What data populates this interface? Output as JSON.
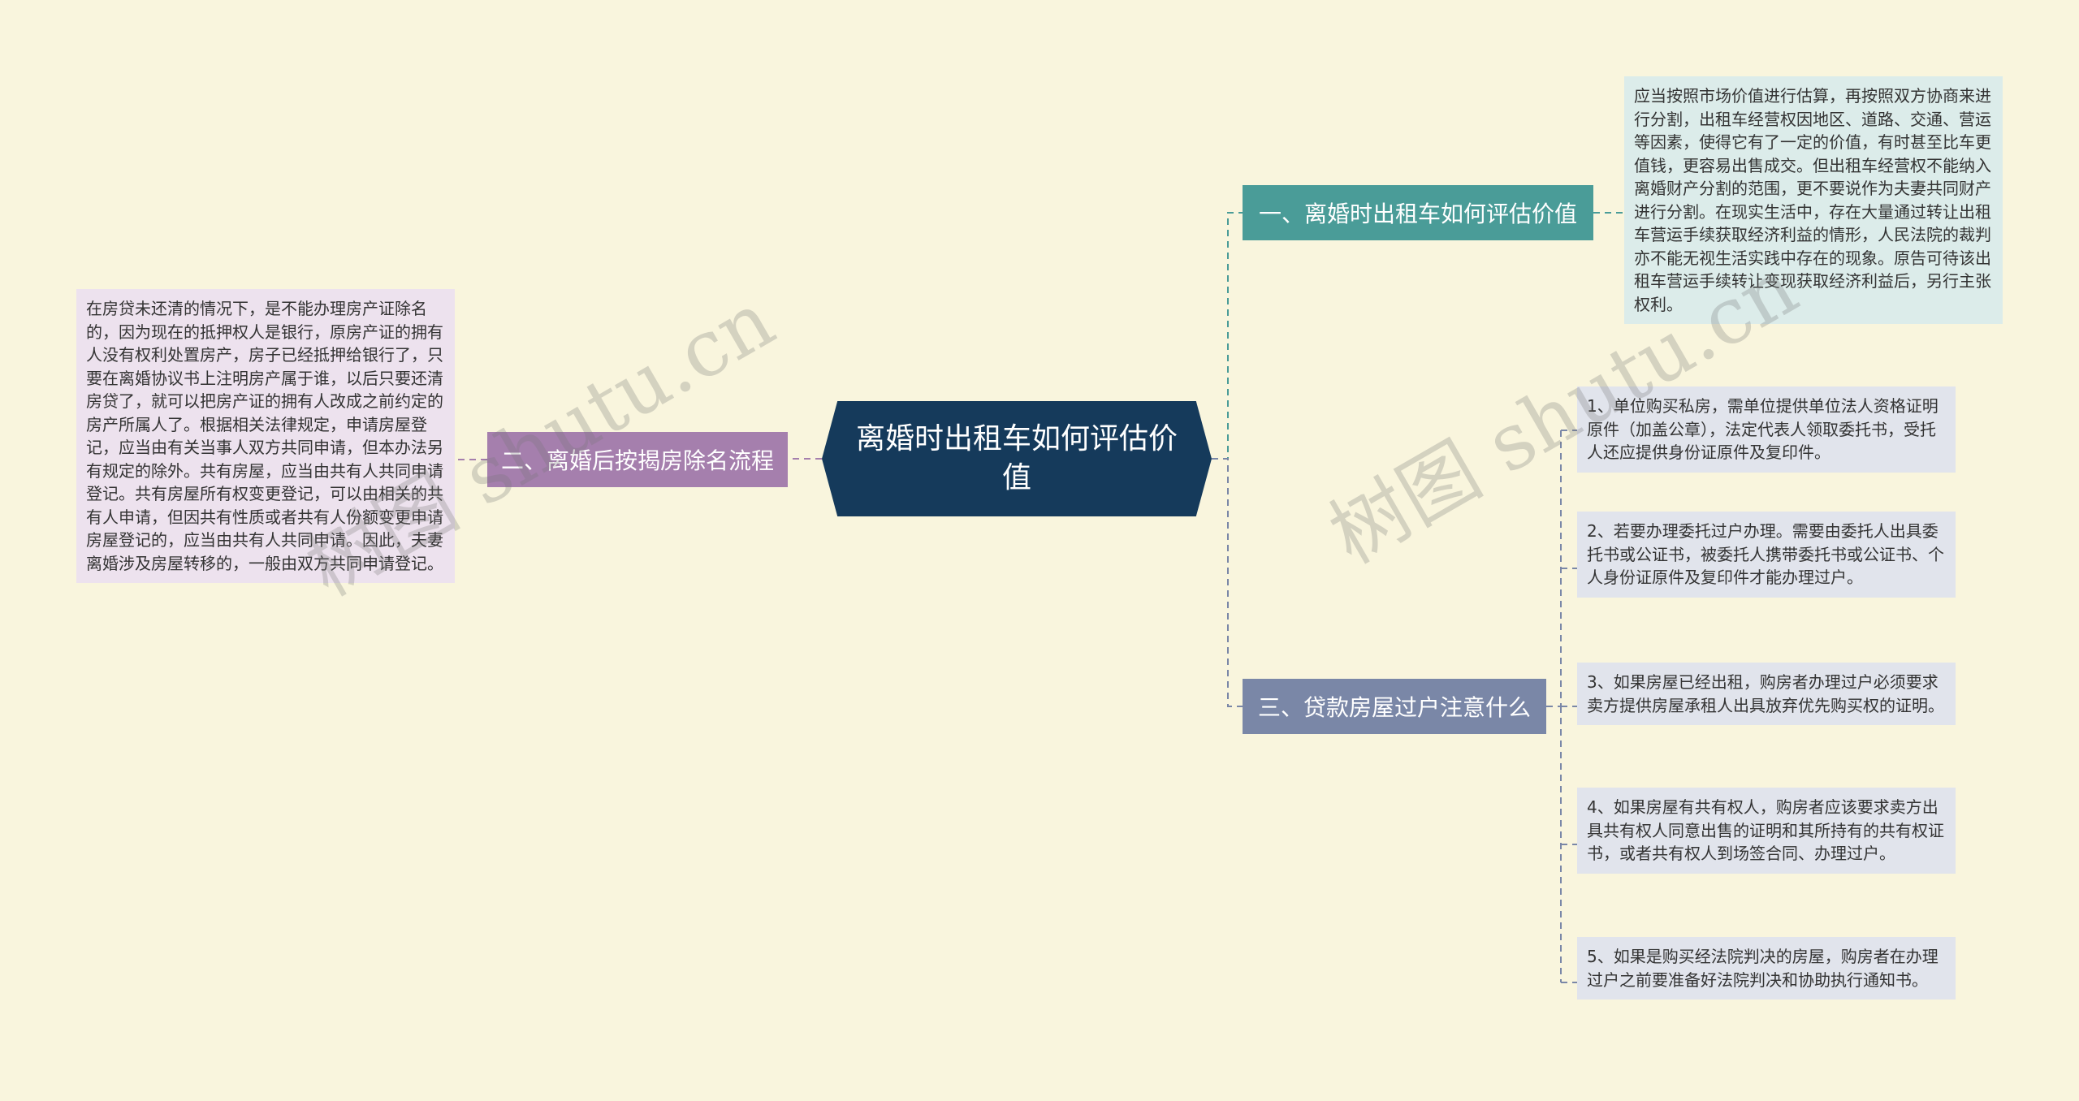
{
  "root": {
    "title": "离婚时出租车如何评估价值"
  },
  "branches": [
    {
      "label": "一、离婚时出租车如何评估价值",
      "leaves": [
        "应当按照市场价值进行估算，再按照双方协商来进行分割，出租车经营权因地区、道路、交通、营运等因素，使得它有了一定的价值，有时甚至比车更值钱，更容易出售成交。但出租车经营权不能纳入离婚财产分割的范围，更不要说作为夫妻共同财产进行分割。在现实生活中，存在大量通过转让出租车营运手续获取经济利益的情形，人民法院的裁判亦不能无视生活实践中存在的现象。原告可待该出租车营运手续转让变现获取经济利益后，另行主张权利。"
      ]
    },
    {
      "label": "二、离婚后按揭房除名流程",
      "leaves": [
        "在房贷未还清的情况下，是不能办理房产证除名的，因为现在的抵押权人是银行，原房产证的拥有人没有权利处置房产，房子已经抵押给银行了，只要在离婚协议书上注明房产属于谁，以后只要还清房贷了，就可以把房产证的拥有人改成之前约定的房产所属人了。根据相关法律规定，申请房屋登记，应当由有关当事人双方共同申请，但本办法另有规定的除外。共有房屋，应当由共有人共同申请登记。共有房屋所有权变更登记，可以由相关的共有人申请，但因共有性质或者共有人份额变更申请房屋登记的，应当由共有人共同申请。因此，夫妻离婚涉及房屋转移的，一般由双方共同申请登记。"
      ]
    },
    {
      "label": "三、贷款房屋过户注意什么",
      "leaves": [
        "1、单位购买私房，需单位提供单位法人资格证明原件（加盖公章），法定代表人领取委托书，受托人还应提供身份证原件及复印件。",
        "2、若要办理委托过户办理。需要由委托人出具委托书或公证书，被委托人携带委托书或公证书、个人身份证原件及复印件才能办理过户。",
        "3、如果房屋已经出租，购房者办理过户必须要求卖方提供房屋承租人出具放弃优先购买权的证明。",
        "4、如果房屋有共有权人，购房者应该要求卖方出具共有权人同意出售的证明和其所持有的共有权证书，或者共有权人到场签合同、办理过户。",
        "5、如果是购买经法院判决的房屋，购房者在办理过户之前要准备好法院判决和协助执行通知书。"
      ]
    }
  ],
  "watermark": "树图 shutu.cn",
  "colors": {
    "background": "#f9f5dd",
    "root": "#153a5b",
    "branch1": "#4a9c98",
    "branch2": "#a57fad",
    "branch3": "#7a87a7",
    "leaf1": "#dcecea",
    "leaf2": "#ede2ee",
    "leaf3": "#e1e4ec"
  }
}
